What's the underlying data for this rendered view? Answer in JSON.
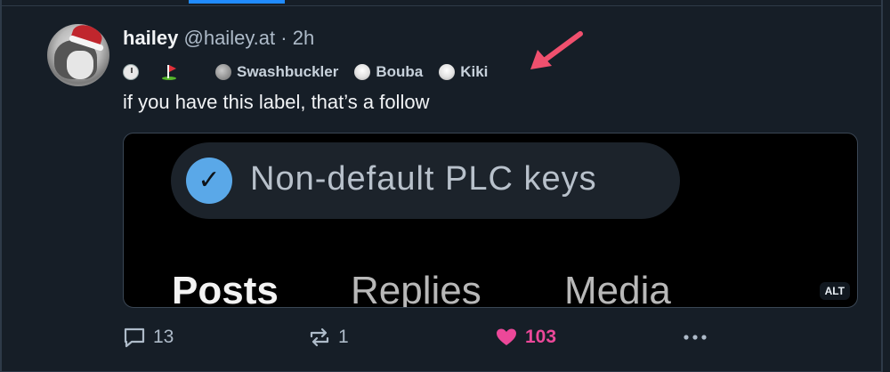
{
  "post": {
    "author": {
      "display_name": "hailey",
      "handle": "@hailey.at",
      "separator": "·",
      "timestamp": "2h"
    },
    "labels": [
      {
        "icon": "clock-badge-icon",
        "text": ""
      },
      {
        "icon": "golf-flag-icon",
        "text": ""
      },
      {
        "icon": "swashbuckler-avatar-icon",
        "text": "Swashbuckler"
      },
      {
        "icon": "bouba-avatar-icon",
        "text": "Bouba"
      },
      {
        "icon": "kiki-avatar-icon",
        "text": "Kiki"
      }
    ],
    "text": "if you have this label, that’s a follow",
    "image": {
      "pill_text": "Non-default PLC keys",
      "tabs": [
        "Posts",
        "Replies",
        "Media"
      ],
      "alt_badge": "ALT"
    },
    "actions": {
      "reply_count": "13",
      "repost_count": "1",
      "like_count": "103"
    }
  },
  "colors": {
    "background": "#161e27",
    "accent_blue": "#208bfe",
    "like_pink": "#ec4899",
    "annotation_arrow": "#f0506e"
  }
}
